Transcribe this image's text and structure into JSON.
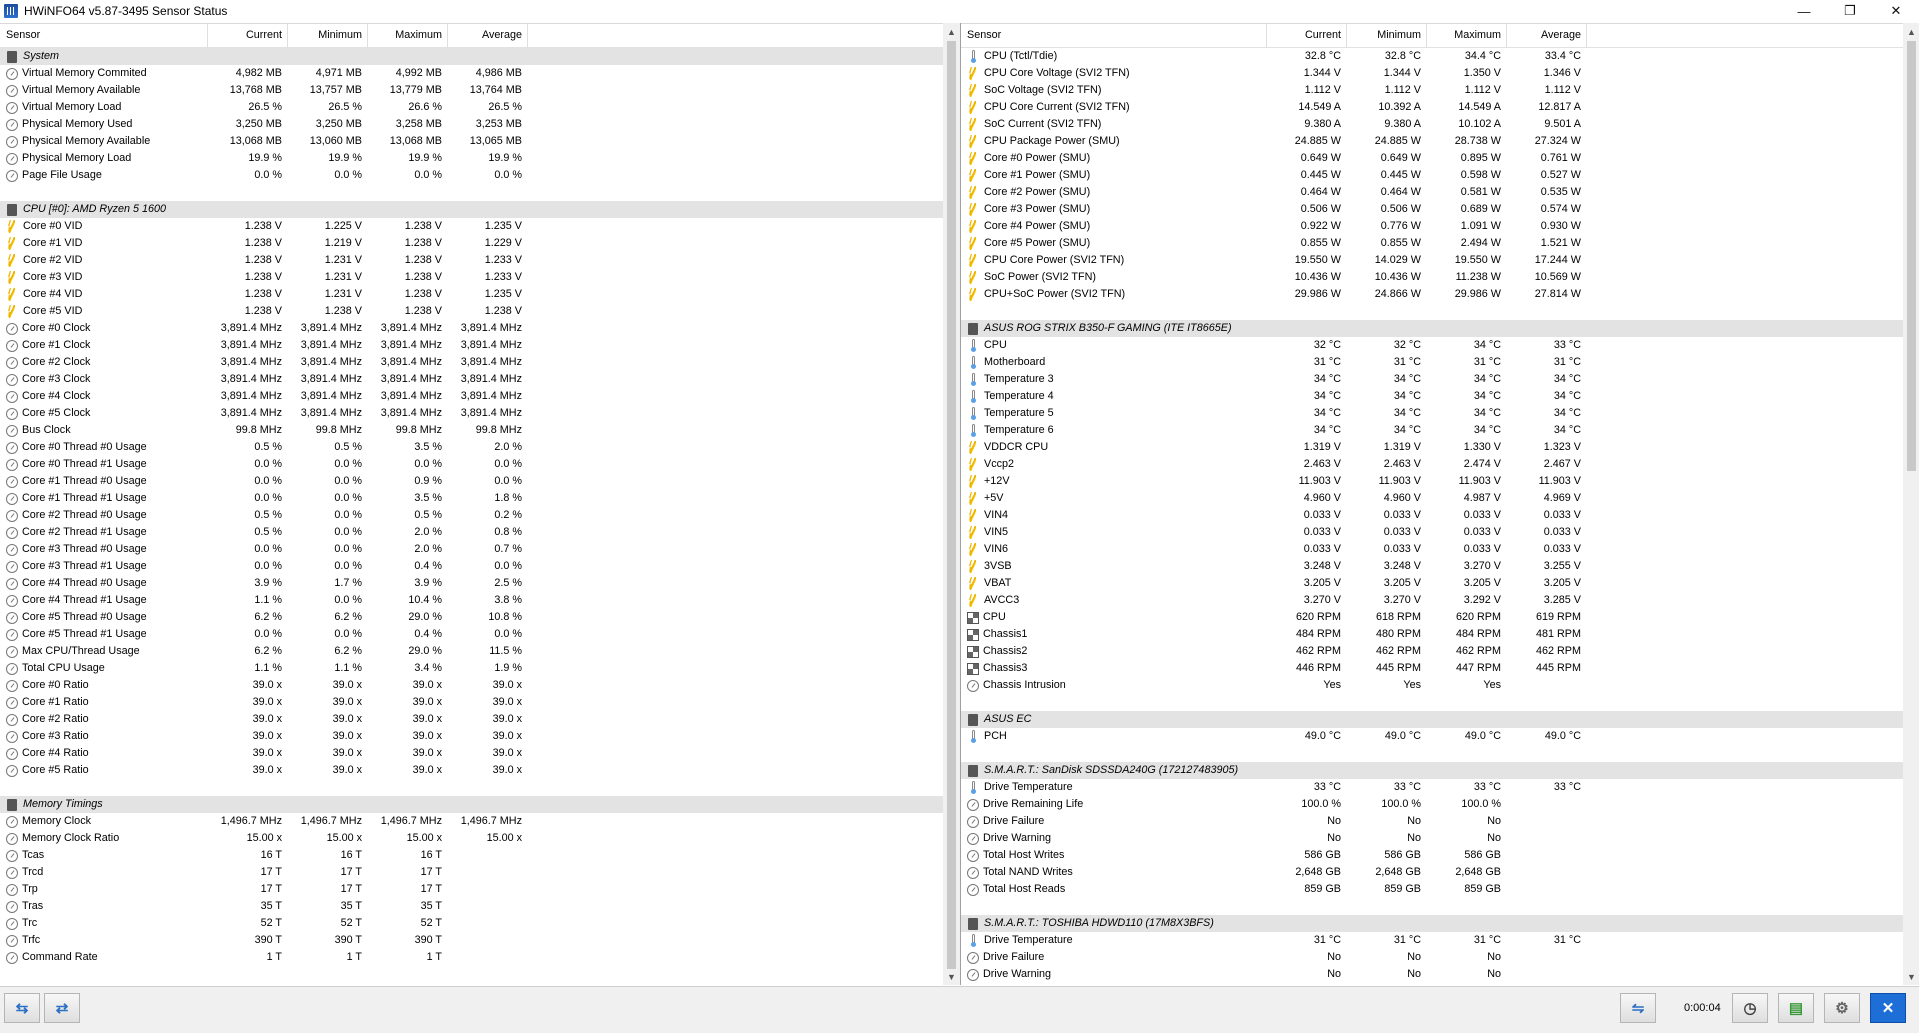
{
  "window": {
    "title": "HWiNFO64 v5.87-3495 Sensor Status",
    "minimize": "—",
    "restore": "❐",
    "close": "✕"
  },
  "columns": {
    "sensor": "Sensor",
    "current": "Current",
    "minimum": "Minimum",
    "maximum": "Maximum",
    "average": "Average"
  },
  "left_rows": [
    {
      "t": "group",
      "n": "System"
    },
    {
      "i": "gauge",
      "n": "Virtual Memory Commited",
      "v": [
        "4,982 MB",
        "4,971 MB",
        "4,992 MB",
        "4,986 MB"
      ]
    },
    {
      "i": "gauge",
      "n": "Virtual Memory Available",
      "v": [
        "13,768 MB",
        "13,757 MB",
        "13,779 MB",
        "13,764 MB"
      ]
    },
    {
      "i": "gauge",
      "n": "Virtual Memory Load",
      "v": [
        "26.5 %",
        "26.5 %",
        "26.6 %",
        "26.5 %"
      ]
    },
    {
      "i": "gauge",
      "n": "Physical Memory Used",
      "v": [
        "3,250 MB",
        "3,250 MB",
        "3,258 MB",
        "3,253 MB"
      ]
    },
    {
      "i": "gauge",
      "n": "Physical Memory Available",
      "v": [
        "13,068 MB",
        "13,060 MB",
        "13,068 MB",
        "13,065 MB"
      ]
    },
    {
      "i": "gauge",
      "n": "Physical Memory Load",
      "v": [
        "19.9 %",
        "19.9 %",
        "19.9 %",
        "19.9 %"
      ]
    },
    {
      "i": "gauge",
      "n": "Page File Usage",
      "v": [
        "0.0 %",
        "0.0 %",
        "0.0 %",
        "0.0 %"
      ]
    },
    {
      "t": "blank"
    },
    {
      "t": "group",
      "n": "CPU [#0]: AMD Ryzen 5 1600"
    },
    {
      "i": "bolt",
      "n": "Core #0 VID",
      "v": [
        "1.238 V",
        "1.225 V",
        "1.238 V",
        "1.235 V"
      ]
    },
    {
      "i": "bolt",
      "n": "Core #1 VID",
      "v": [
        "1.238 V",
        "1.219 V",
        "1.238 V",
        "1.229 V"
      ]
    },
    {
      "i": "bolt",
      "n": "Core #2 VID",
      "v": [
        "1.238 V",
        "1.231 V",
        "1.238 V",
        "1.233 V"
      ]
    },
    {
      "i": "bolt",
      "n": "Core #3 VID",
      "v": [
        "1.238 V",
        "1.231 V",
        "1.238 V",
        "1.233 V"
      ]
    },
    {
      "i": "bolt",
      "n": "Core #4 VID",
      "v": [
        "1.238 V",
        "1.231 V",
        "1.238 V",
        "1.235 V"
      ]
    },
    {
      "i": "bolt",
      "n": "Core #5 VID",
      "v": [
        "1.238 V",
        "1.238 V",
        "1.238 V",
        "1.238 V"
      ]
    },
    {
      "i": "gauge",
      "n": "Core #0 Clock",
      "v": [
        "3,891.4 MHz",
        "3,891.4 MHz",
        "3,891.4 MHz",
        "3,891.4 MHz"
      ]
    },
    {
      "i": "gauge",
      "n": "Core #1 Clock",
      "v": [
        "3,891.4 MHz",
        "3,891.4 MHz",
        "3,891.4 MHz",
        "3,891.4 MHz"
      ]
    },
    {
      "i": "gauge",
      "n": "Core #2 Clock",
      "v": [
        "3,891.4 MHz",
        "3,891.4 MHz",
        "3,891.4 MHz",
        "3,891.4 MHz"
      ]
    },
    {
      "i": "gauge",
      "n": "Core #3 Clock",
      "v": [
        "3,891.4 MHz",
        "3,891.4 MHz",
        "3,891.4 MHz",
        "3,891.4 MHz"
      ]
    },
    {
      "i": "gauge",
      "n": "Core #4 Clock",
      "v": [
        "3,891.4 MHz",
        "3,891.4 MHz",
        "3,891.4 MHz",
        "3,891.4 MHz"
      ]
    },
    {
      "i": "gauge",
      "n": "Core #5 Clock",
      "v": [
        "3,891.4 MHz",
        "3,891.4 MHz",
        "3,891.4 MHz",
        "3,891.4 MHz"
      ]
    },
    {
      "i": "gauge",
      "n": "Bus Clock",
      "v": [
        "99.8 MHz",
        "99.8 MHz",
        "99.8 MHz",
        "99.8 MHz"
      ]
    },
    {
      "i": "gauge",
      "n": "Core #0 Thread #0 Usage",
      "v": [
        "0.5 %",
        "0.5 %",
        "3.5 %",
        "2.0 %"
      ]
    },
    {
      "i": "gauge",
      "n": "Core #0 Thread #1 Usage",
      "v": [
        "0.0 %",
        "0.0 %",
        "0.0 %",
        "0.0 %"
      ]
    },
    {
      "i": "gauge",
      "n": "Core #1 Thread #0 Usage",
      "v": [
        "0.0 %",
        "0.0 %",
        "0.9 %",
        "0.0 %"
      ]
    },
    {
      "i": "gauge",
      "n": "Core #1 Thread #1 Usage",
      "v": [
        "0.0 %",
        "0.0 %",
        "3.5 %",
        "1.8 %"
      ]
    },
    {
      "i": "gauge",
      "n": "Core #2 Thread #0 Usage",
      "v": [
        "0.5 %",
        "0.0 %",
        "0.5 %",
        "0.2 %"
      ]
    },
    {
      "i": "gauge",
      "n": "Core #2 Thread #1 Usage",
      "v": [
        "0.5 %",
        "0.0 %",
        "2.0 %",
        "0.8 %"
      ]
    },
    {
      "i": "gauge",
      "n": "Core #3 Thread #0 Usage",
      "v": [
        "0.0 %",
        "0.0 %",
        "2.0 %",
        "0.7 %"
      ]
    },
    {
      "i": "gauge",
      "n": "Core #3 Thread #1 Usage",
      "v": [
        "0.0 %",
        "0.0 %",
        "0.4 %",
        "0.0 %"
      ]
    },
    {
      "i": "gauge",
      "n": "Core #4 Thread #0 Usage",
      "v": [
        "3.9 %",
        "1.7 %",
        "3.9 %",
        "2.5 %"
      ]
    },
    {
      "i": "gauge",
      "n": "Core #4 Thread #1 Usage",
      "v": [
        "1.1 %",
        "0.0 %",
        "10.4 %",
        "3.8 %"
      ]
    },
    {
      "i": "gauge",
      "n": "Core #5 Thread #0 Usage",
      "v": [
        "6.2 %",
        "6.2 %",
        "29.0 %",
        "10.8 %"
      ]
    },
    {
      "i": "gauge",
      "n": "Core #5 Thread #1 Usage",
      "v": [
        "0.0 %",
        "0.0 %",
        "0.4 %",
        "0.0 %"
      ]
    },
    {
      "i": "gauge",
      "n": "Max CPU/Thread Usage",
      "v": [
        "6.2 %",
        "6.2 %",
        "29.0 %",
        "11.5 %"
      ]
    },
    {
      "i": "gauge",
      "n": "Total CPU Usage",
      "v": [
        "1.1 %",
        "1.1 %",
        "3.4 %",
        "1.9 %"
      ]
    },
    {
      "i": "gauge",
      "n": "Core #0 Ratio",
      "v": [
        "39.0 x",
        "39.0 x",
        "39.0 x",
        "39.0 x"
      ]
    },
    {
      "i": "gauge",
      "n": "Core #1 Ratio",
      "v": [
        "39.0 x",
        "39.0 x",
        "39.0 x",
        "39.0 x"
      ]
    },
    {
      "i": "gauge",
      "n": "Core #2 Ratio",
      "v": [
        "39.0 x",
        "39.0 x",
        "39.0 x",
        "39.0 x"
      ]
    },
    {
      "i": "gauge",
      "n": "Core #3 Ratio",
      "v": [
        "39.0 x",
        "39.0 x",
        "39.0 x",
        "39.0 x"
      ]
    },
    {
      "i": "gauge",
      "n": "Core #4 Ratio",
      "v": [
        "39.0 x",
        "39.0 x",
        "39.0 x",
        "39.0 x"
      ]
    },
    {
      "i": "gauge",
      "n": "Core #5 Ratio",
      "v": [
        "39.0 x",
        "39.0 x",
        "39.0 x",
        "39.0 x"
      ]
    },
    {
      "t": "blank"
    },
    {
      "t": "group",
      "n": "Memory Timings"
    },
    {
      "i": "gauge",
      "n": "Memory Clock",
      "v": [
        "1,496.7 MHz",
        "1,496.7 MHz",
        "1,496.7 MHz",
        "1,496.7 MHz"
      ]
    },
    {
      "i": "gauge",
      "n": "Memory Clock Ratio",
      "v": [
        "15.00 x",
        "15.00 x",
        "15.00 x",
        "15.00 x"
      ]
    },
    {
      "i": "gauge",
      "n": "Tcas",
      "v": [
        "16 T",
        "16 T",
        "16 T",
        ""
      ]
    },
    {
      "i": "gauge",
      "n": "Trcd",
      "v": [
        "17 T",
        "17 T",
        "17 T",
        ""
      ]
    },
    {
      "i": "gauge",
      "n": "Trp",
      "v": [
        "17 T",
        "17 T",
        "17 T",
        ""
      ]
    },
    {
      "i": "gauge",
      "n": "Tras",
      "v": [
        "35 T",
        "35 T",
        "35 T",
        ""
      ]
    },
    {
      "i": "gauge",
      "n": "Trc",
      "v": [
        "52 T",
        "52 T",
        "52 T",
        ""
      ]
    },
    {
      "i": "gauge",
      "n": "Trfc",
      "v": [
        "390 T",
        "390 T",
        "390 T",
        ""
      ]
    },
    {
      "i": "gauge",
      "n": "Command Rate",
      "v": [
        "1 T",
        "1 T",
        "1 T",
        ""
      ]
    }
  ],
  "right_rows": [
    {
      "i": "therm",
      "n": "CPU (Tctl/Tdie)",
      "v": [
        "32.8 °C",
        "32.8 °C",
        "34.4 °C",
        "33.4 °C"
      ]
    },
    {
      "i": "bolt",
      "n": "CPU Core Voltage (SVI2 TFN)",
      "v": [
        "1.344 V",
        "1.344 V",
        "1.350 V",
        "1.346 V"
      ]
    },
    {
      "i": "bolt",
      "n": "SoC Voltage (SVI2 TFN)",
      "v": [
        "1.112 V",
        "1.112 V",
        "1.112 V",
        "1.112 V"
      ]
    },
    {
      "i": "bolt",
      "n": "CPU Core Current (SVI2 TFN)",
      "v": [
        "14.549 A",
        "10.392 A",
        "14.549 A",
        "12.817 A"
      ]
    },
    {
      "i": "bolt",
      "n": "SoC Current (SVI2 TFN)",
      "v": [
        "9.380 A",
        "9.380 A",
        "10.102 A",
        "9.501 A"
      ]
    },
    {
      "i": "bolt",
      "n": "CPU Package Power (SMU)",
      "v": [
        "24.885 W",
        "24.885 W",
        "28.738 W",
        "27.324 W"
      ]
    },
    {
      "i": "bolt",
      "n": "Core #0 Power (SMU)",
      "v": [
        "0.649 W",
        "0.649 W",
        "0.895 W",
        "0.761 W"
      ]
    },
    {
      "i": "bolt",
      "n": "Core #1 Power (SMU)",
      "v": [
        "0.445 W",
        "0.445 W",
        "0.598 W",
        "0.527 W"
      ]
    },
    {
      "i": "bolt",
      "n": "Core #2 Power (SMU)",
      "v": [
        "0.464 W",
        "0.464 W",
        "0.581 W",
        "0.535 W"
      ]
    },
    {
      "i": "bolt",
      "n": "Core #3 Power (SMU)",
      "v": [
        "0.506 W",
        "0.506 W",
        "0.689 W",
        "0.574 W"
      ]
    },
    {
      "i": "bolt",
      "n": "Core #4 Power (SMU)",
      "v": [
        "0.922 W",
        "0.776 W",
        "1.091 W",
        "0.930 W"
      ]
    },
    {
      "i": "bolt",
      "n": "Core #5 Power (SMU)",
      "v": [
        "0.855 W",
        "0.855 W",
        "2.494 W",
        "1.521 W"
      ]
    },
    {
      "i": "bolt",
      "n": "CPU Core Power (SVI2 TFN)",
      "v": [
        "19.550 W",
        "14.029 W",
        "19.550 W",
        "17.244 W"
      ]
    },
    {
      "i": "bolt",
      "n": "SoC Power (SVI2 TFN)",
      "v": [
        "10.436 W",
        "10.436 W",
        "11.238 W",
        "10.569 W"
      ]
    },
    {
      "i": "bolt",
      "n": "CPU+SoC Power (SVI2 TFN)",
      "v": [
        "29.986 W",
        "24.866 W",
        "29.986 W",
        "27.814 W"
      ]
    },
    {
      "t": "blank"
    },
    {
      "t": "group",
      "n": "ASUS ROG STRIX B350-F GAMING (ITE IT8665E)"
    },
    {
      "i": "therm",
      "n": "CPU",
      "v": [
        "32 °C",
        "32 °C",
        "34 °C",
        "33 °C"
      ]
    },
    {
      "i": "therm",
      "n": "Motherboard",
      "v": [
        "31 °C",
        "31 °C",
        "31 °C",
        "31 °C"
      ]
    },
    {
      "i": "therm",
      "n": "Temperature 3",
      "v": [
        "34 °C",
        "34 °C",
        "34 °C",
        "34 °C"
      ]
    },
    {
      "i": "therm",
      "n": "Temperature 4",
      "v": [
        "34 °C",
        "34 °C",
        "34 °C",
        "34 °C"
      ]
    },
    {
      "i": "therm",
      "n": "Temperature 5",
      "v": [
        "34 °C",
        "34 °C",
        "34 °C",
        "34 °C"
      ]
    },
    {
      "i": "therm",
      "n": "Temperature 6",
      "v": [
        "34 °C",
        "34 °C",
        "34 °C",
        "34 °C"
      ]
    },
    {
      "i": "bolt",
      "n": "VDDCR CPU",
      "v": [
        "1.319 V",
        "1.319 V",
        "1.330 V",
        "1.323 V"
      ]
    },
    {
      "i": "bolt",
      "n": "Vccp2",
      "v": [
        "2.463 V",
        "2.463 V",
        "2.474 V",
        "2.467 V"
      ]
    },
    {
      "i": "bolt",
      "n": "+12V",
      "v": [
        "11.903 V",
        "11.903 V",
        "11.903 V",
        "11.903 V"
      ]
    },
    {
      "i": "bolt",
      "n": "+5V",
      "v": [
        "4.960 V",
        "4.960 V",
        "4.987 V",
        "4.969 V"
      ]
    },
    {
      "i": "bolt",
      "n": "VIN4",
      "v": [
        "0.033 V",
        "0.033 V",
        "0.033 V",
        "0.033 V"
      ]
    },
    {
      "i": "bolt",
      "n": "VIN5",
      "v": [
        "0.033 V",
        "0.033 V",
        "0.033 V",
        "0.033 V"
      ]
    },
    {
      "i": "bolt",
      "n": "VIN6",
      "v": [
        "0.033 V",
        "0.033 V",
        "0.033 V",
        "0.033 V"
      ]
    },
    {
      "i": "bolt",
      "n": "3VSB",
      "v": [
        "3.248 V",
        "3.248 V",
        "3.270 V",
        "3.255 V"
      ]
    },
    {
      "i": "bolt",
      "n": "VBAT",
      "v": [
        "3.205 V",
        "3.205 V",
        "3.205 V",
        "3.205 V"
      ]
    },
    {
      "i": "bolt",
      "n": "AVCC3",
      "v": [
        "3.270 V",
        "3.270 V",
        "3.292 V",
        "3.285 V"
      ]
    },
    {
      "i": "fan",
      "n": "CPU",
      "v": [
        "620 RPM",
        "618 RPM",
        "620 RPM",
        "619 RPM"
      ]
    },
    {
      "i": "fan",
      "n": "Chassis1",
      "v": [
        "484 RPM",
        "480 RPM",
        "484 RPM",
        "481 RPM"
      ]
    },
    {
      "i": "fan",
      "n": "Chassis2",
      "v": [
        "462 RPM",
        "462 RPM",
        "462 RPM",
        "462 RPM"
      ]
    },
    {
      "i": "fan",
      "n": "Chassis3",
      "v": [
        "446 RPM",
        "445 RPM",
        "447 RPM",
        "445 RPM"
      ]
    },
    {
      "i": "gauge",
      "n": "Chassis Intrusion",
      "v": [
        "Yes",
        "Yes",
        "Yes",
        ""
      ]
    },
    {
      "t": "blank"
    },
    {
      "t": "group",
      "n": "ASUS EC"
    },
    {
      "i": "therm",
      "n": "PCH",
      "v": [
        "49.0 °C",
        "49.0 °C",
        "49.0 °C",
        "49.0 °C"
      ]
    },
    {
      "t": "blank"
    },
    {
      "t": "group",
      "n": "S.M.A.R.T.: SanDisk SDSSDA240G (172127483905)"
    },
    {
      "i": "therm",
      "n": "Drive Temperature",
      "v": [
        "33 °C",
        "33 °C",
        "33 °C",
        "33 °C"
      ]
    },
    {
      "i": "gauge",
      "n": "Drive Remaining Life",
      "v": [
        "100.0 %",
        "100.0 %",
        "100.0 %",
        ""
      ]
    },
    {
      "i": "gauge",
      "n": "Drive Failure",
      "v": [
        "No",
        "No",
        "No",
        ""
      ]
    },
    {
      "i": "gauge",
      "n": "Drive Warning",
      "v": [
        "No",
        "No",
        "No",
        ""
      ]
    },
    {
      "i": "gauge",
      "n": "Total Host Writes",
      "v": [
        "586 GB",
        "586 GB",
        "586 GB",
        ""
      ]
    },
    {
      "i": "gauge",
      "n": "Total NAND Writes",
      "v": [
        "2,648 GB",
        "2,648 GB",
        "2,648 GB",
        ""
      ]
    },
    {
      "i": "gauge",
      "n": "Total Host Reads",
      "v": [
        "859 GB",
        "859 GB",
        "859 GB",
        ""
      ]
    },
    {
      "t": "blank"
    },
    {
      "t": "group",
      "n": "S.M.A.R.T.: TOSHIBA HDWD110 (17M8X3BFS)"
    },
    {
      "i": "therm",
      "n": "Drive Temperature",
      "v": [
        "31 °C",
        "31 °C",
        "31 °C",
        "31 °C"
      ]
    },
    {
      "i": "gauge",
      "n": "Drive Failure",
      "v": [
        "No",
        "No",
        "No",
        ""
      ]
    },
    {
      "i": "gauge",
      "n": "Drive Warning",
      "v": [
        "No",
        "No",
        "No",
        ""
      ]
    }
  ],
  "statusbar": {
    "nav_left": "⇆",
    "nav_right": "⇄",
    "elapsed": "0:00:04",
    "clock_icon": "◷",
    "report_icon": "▤",
    "settings_icon": "⚙",
    "close_icon": "✕",
    "network_icon": "⇋"
  }
}
